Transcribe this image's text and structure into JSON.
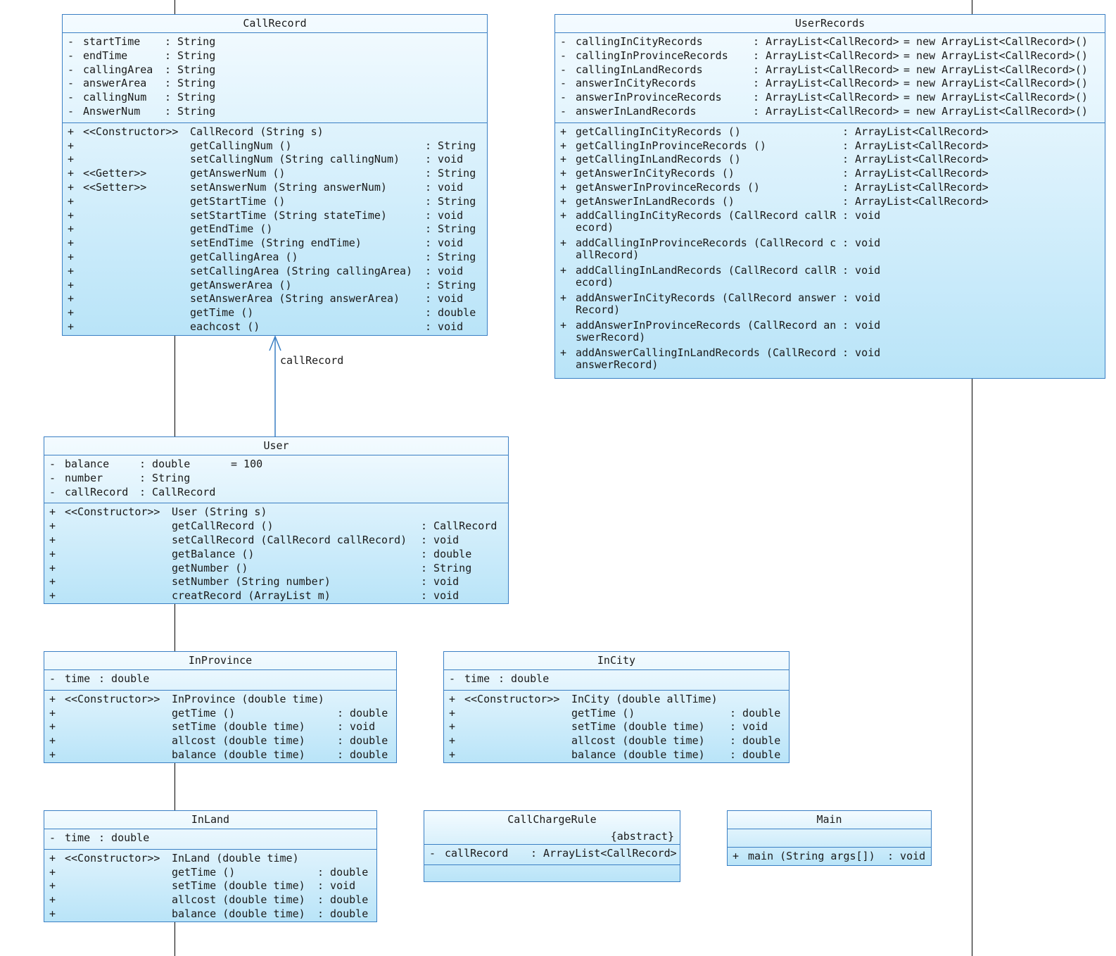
{
  "classes": {
    "callrecord": {
      "name": "CallRecord",
      "attributes": [
        {
          "vis": "-",
          "name": "startTime",
          "type": ": String"
        },
        {
          "vis": "-",
          "name": "endTime",
          "type": ": String"
        },
        {
          "vis": "-",
          "name": "callingArea",
          "type": ": String"
        },
        {
          "vis": "-",
          "name": "answerArea",
          "type": ": String"
        },
        {
          "vis": "-",
          "name": "callingNum",
          "type": ": String"
        },
        {
          "vis": "-",
          "name": "AnswerNum",
          "type": ": String"
        }
      ],
      "methods": [
        {
          "vis": "+",
          "stereo": "<<Constructor>>",
          "name": "CallRecord (String s)",
          "ret": ""
        },
        {
          "vis": "+",
          "stereo": "",
          "name": "getCallingNum ()",
          "ret": ": String"
        },
        {
          "vis": "+",
          "stereo": "",
          "name": "setCallingNum (String callingNum)",
          "ret": ": void"
        },
        {
          "vis": "+",
          "stereo": "<<Getter>>",
          "name": "getAnswerNum ()",
          "ret": ": String"
        },
        {
          "vis": "+",
          "stereo": "<<Setter>>",
          "name": "setAnswerNum (String answerNum)",
          "ret": ": void"
        },
        {
          "vis": "+",
          "stereo": "",
          "name": "getStartTime ()",
          "ret": ": String"
        },
        {
          "vis": "+",
          "stereo": "",
          "name": "setStartTime (String stateTime)",
          "ret": ": void"
        },
        {
          "vis": "+",
          "stereo": "",
          "name": "getEndTime ()",
          "ret": ": String"
        },
        {
          "vis": "+",
          "stereo": "",
          "name": "setEndTime (String endTime)",
          "ret": ": void"
        },
        {
          "vis": "+",
          "stereo": "",
          "name": "getCallingArea ()",
          "ret": ": String"
        },
        {
          "vis": "+",
          "stereo": "",
          "name": "setCallingArea (String callingArea)",
          "ret": ": void"
        },
        {
          "vis": "+",
          "stereo": "",
          "name": "getAnswerArea ()",
          "ret": ": String"
        },
        {
          "vis": "+",
          "stereo": "",
          "name": "setAnswerArea (String answerArea)",
          "ret": ": void"
        },
        {
          "vis": "+",
          "stereo": "",
          "name": "getTime ()",
          "ret": ": double"
        },
        {
          "vis": "+",
          "stereo": "",
          "name": "eachcost ()",
          "ret": ": void"
        }
      ]
    },
    "userrecords": {
      "name": "UserRecords",
      "attributes": [
        {
          "vis": "-",
          "name": "callingInCityRecords",
          "type": ": ArrayList<CallRecord>",
          "default": "= new ArrayList<CallRecord>()"
        },
        {
          "vis": "-",
          "name": "callingInProvinceRecords",
          "type": ": ArrayList<CallRecord>",
          "default": "= new ArrayList<CallRecord>()"
        },
        {
          "vis": "-",
          "name": "callingInLandRecords",
          "type": ": ArrayList<CallRecord>",
          "default": "= new ArrayList<CallRecord>()"
        },
        {
          "vis": "-",
          "name": "answerInCityRecords",
          "type": ": ArrayList<CallRecord>",
          "default": "= new ArrayList<CallRecord>()"
        },
        {
          "vis": "-",
          "name": "answerInProvinceRecords",
          "type": ": ArrayList<CallRecord>",
          "default": "= new ArrayList<CallRecord>()"
        },
        {
          "vis": "-",
          "name": "answerInLandRecords",
          "type": ": ArrayList<CallRecord>",
          "default": "= new ArrayList<CallRecord>()"
        }
      ],
      "methods": [
        {
          "vis": "+",
          "name": "getCallingInCityRecords ()",
          "ret": ": ArrayList<CallRecord>"
        },
        {
          "vis": "+",
          "name": "getCallingInProvinceRecords ()",
          "ret": ": ArrayList<CallRecord>"
        },
        {
          "vis": "+",
          "name": "getCallingInLandRecords ()",
          "ret": ": ArrayList<CallRecord>"
        },
        {
          "vis": "+",
          "name": "getAnswerInCityRecords ()",
          "ret": ": ArrayList<CallRecord>"
        },
        {
          "vis": "+",
          "name": "getAnswerInProvinceRecords ()",
          "ret": ": ArrayList<CallRecord>"
        },
        {
          "vis": "+",
          "name": "getAnswerInLandRecords ()",
          "ret": ": ArrayList<CallRecord>"
        },
        {
          "vis": "+",
          "name": "addCallingInCityRecords (CallRecord callRecord)",
          "ret": ": void"
        },
        {
          "vis": "+",
          "name": "addCallingInProvinceRecords (CallRecord callRecord)",
          "ret": ": void"
        },
        {
          "vis": "+",
          "name": "addCallingInLandRecords (CallRecord callRecord)",
          "ret": ": void"
        },
        {
          "vis": "+",
          "name": "addAnswerInCityRecords (CallRecord answerRecord)",
          "ret": ": void"
        },
        {
          "vis": "+",
          "name": "addAnswerInProvinceRecords (CallRecord answerRecord)",
          "ret": ": void"
        },
        {
          "vis": "+",
          "name": "addAnswerCallingInLandRecords (CallRecord answerRecord)",
          "ret": ": void"
        }
      ]
    },
    "user": {
      "name": "User",
      "attributes": [
        {
          "vis": "-",
          "name": "balance",
          "type": ": double",
          "default": "= 100"
        },
        {
          "vis": "-",
          "name": "number",
          "type": ": String",
          "default": ""
        },
        {
          "vis": "-",
          "name": "callRecord",
          "type": ": CallRecord",
          "default": ""
        }
      ],
      "methods": [
        {
          "vis": "+",
          "stereo": "<<Constructor>>",
          "name": "User (String s)",
          "ret": ""
        },
        {
          "vis": "+",
          "stereo": "",
          "name": "getCallRecord ()",
          "ret": ": CallRecord"
        },
        {
          "vis": "+",
          "stereo": "",
          "name": "setCallRecord (CallRecord callRecord)",
          "ret": ": void"
        },
        {
          "vis": "+",
          "stereo": "",
          "name": "getBalance ()",
          "ret": ": double"
        },
        {
          "vis": "+",
          "stereo": "",
          "name": "getNumber ()",
          "ret": ": String"
        },
        {
          "vis": "+",
          "stereo": "",
          "name": "setNumber (String number)",
          "ret": ": void"
        },
        {
          "vis": "+",
          "stereo": "",
          "name": "creatRecord (ArrayList m)",
          "ret": ": void"
        }
      ]
    },
    "inprovince": {
      "name": "InProvince",
      "attributes": [
        {
          "vis": "-",
          "name": "time",
          "type": ": double"
        }
      ],
      "methods": [
        {
          "vis": "+",
          "stereo": "<<Constructor>>",
          "name": "InProvince (double time)",
          "ret": ""
        },
        {
          "vis": "+",
          "stereo": "",
          "name": "getTime ()",
          "ret": ": double"
        },
        {
          "vis": "+",
          "stereo": "",
          "name": "setTime (double time)",
          "ret": ": void"
        },
        {
          "vis": "+",
          "stereo": "",
          "name": "allcost (double time)",
          "ret": ": double"
        },
        {
          "vis": "+",
          "stereo": "",
          "name": "balance (double time)",
          "ret": ": double"
        }
      ]
    },
    "incity": {
      "name": "InCity",
      "attributes": [
        {
          "vis": "-",
          "name": "time",
          "type": ": double"
        }
      ],
      "methods": [
        {
          "vis": "+",
          "stereo": "<<Constructor>>",
          "name": "InCity (double allTime)",
          "ret": ""
        },
        {
          "vis": "+",
          "stereo": "",
          "name": "getTime ()",
          "ret": ": double"
        },
        {
          "vis": "+",
          "stereo": "",
          "name": "setTime (double time)",
          "ret": ": void"
        },
        {
          "vis": "+",
          "stereo": "",
          "name": "allcost (double time)",
          "ret": ": double"
        },
        {
          "vis": "+",
          "stereo": "",
          "name": "balance (double time)",
          "ret": ": double"
        }
      ]
    },
    "inland": {
      "name": "InLand",
      "attributes": [
        {
          "vis": "-",
          "name": "time",
          "type": ": double"
        }
      ],
      "methods": [
        {
          "vis": "+",
          "stereo": "<<Constructor>>",
          "name": "InLand (double time)",
          "ret": ""
        },
        {
          "vis": "+",
          "stereo": "",
          "name": "getTime ()",
          "ret": ": double"
        },
        {
          "vis": "+",
          "stereo": "",
          "name": "setTime (double time)",
          "ret": ": void"
        },
        {
          "vis": "+",
          "stereo": "",
          "name": "allcost (double time)",
          "ret": ": double"
        },
        {
          "vis": "+",
          "stereo": "",
          "name": "balance (double time)",
          "ret": ": double"
        }
      ]
    },
    "callchargerule": {
      "name": "CallChargeRule",
      "modifier": "{abstract}",
      "attributes": [
        {
          "vis": "-",
          "name": "callRecord",
          "type": ": ArrayList<CallRecord>"
        }
      ]
    },
    "main": {
      "name": "Main",
      "methods": [
        {
          "vis": "+",
          "name": "main (String args[])",
          "ret": ": void"
        }
      ]
    }
  },
  "associations": [
    {
      "from": "User",
      "to": "CallRecord",
      "label": "callRecord"
    }
  ],
  "colors": {
    "border": "#3a7fc4",
    "fill_top": "#f4fbff",
    "fill_bottom": "#b9e4f8",
    "connector": "#000000"
  }
}
